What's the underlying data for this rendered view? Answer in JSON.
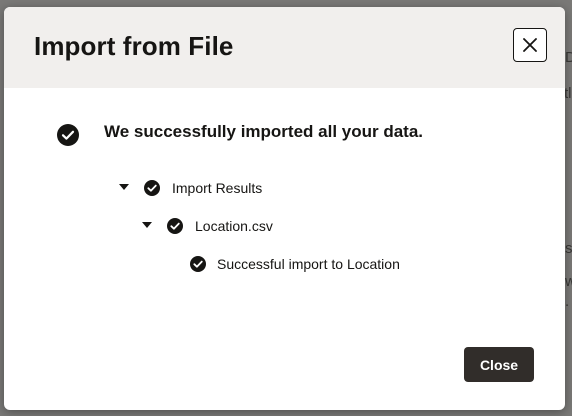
{
  "background": {
    "fragments": [
      "D",
      "tl",
      "s",
      "w",
      "."
    ]
  },
  "dialog": {
    "title": "Import from File",
    "close_icon": "close-icon",
    "message": "We successfully imported all your data.",
    "tree": {
      "root_label": "Import Results",
      "file_label": "Location.csv",
      "result_label": "Successful import to Location"
    },
    "close_button_label": "Close"
  },
  "colors": {
    "header_bg": "#f1efed",
    "primary_button": "#312d2a",
    "text": "#161513",
    "overlay": "#7a7977"
  }
}
